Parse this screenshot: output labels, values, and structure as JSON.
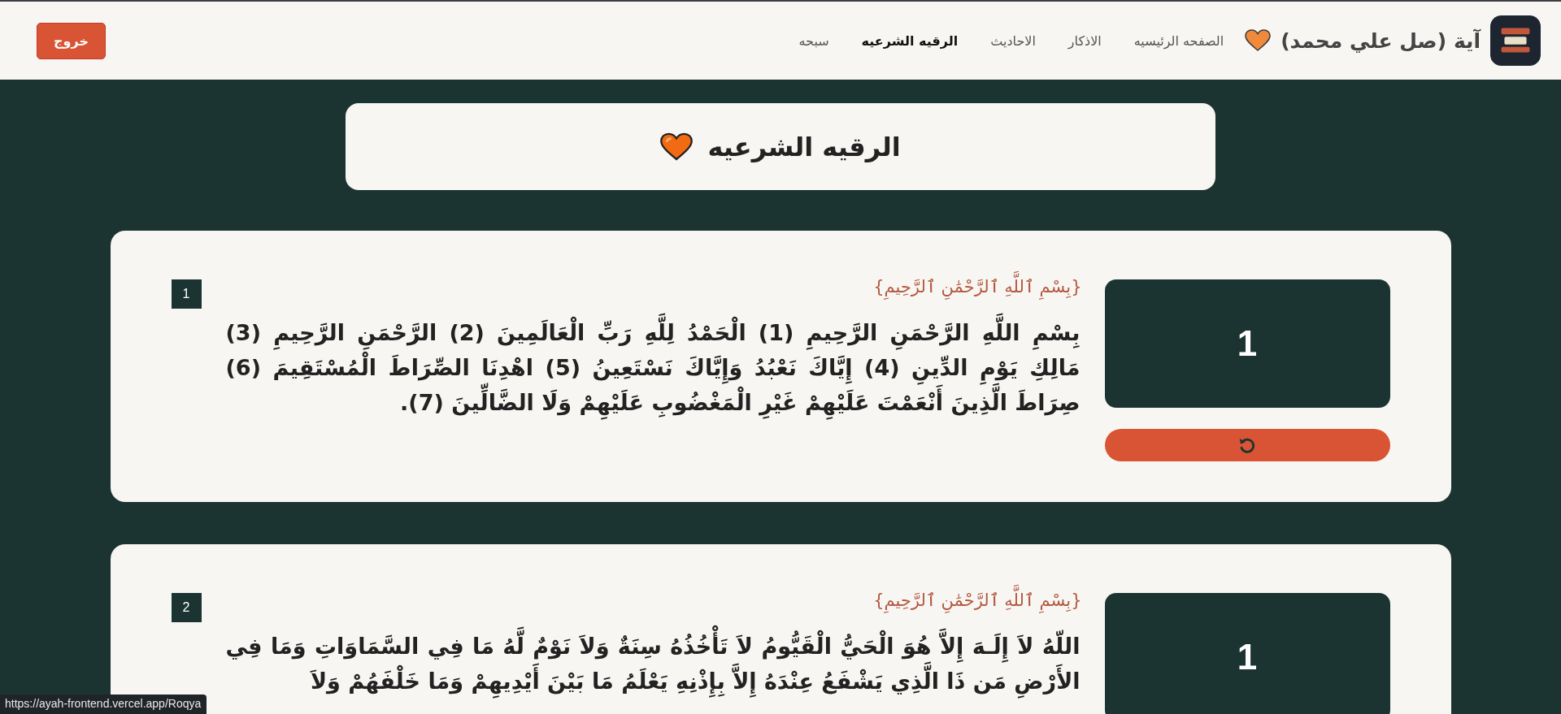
{
  "nav": {
    "brand": "آية (صل علي محمد)",
    "links": [
      {
        "label": "الصفحه الرئيسيه",
        "selected": false
      },
      {
        "label": "الاذكار",
        "selected": false
      },
      {
        "label": "الاحاديث",
        "selected": false
      },
      {
        "label": "الرقيه الشرعيه",
        "selected": true
      },
      {
        "label": "سبحه",
        "selected": false
      }
    ],
    "logout": "خروج"
  },
  "page_title": "الرقيه الشرعيه",
  "cards": [
    {
      "number": "1",
      "heading": "{بِسْمِ ٱللَّهِ ٱلرَّحْمَٰنِ ٱلرَّحِيمِ}",
      "text": "بِسْمِ اللَّهِ الرَّحْمَنِ الرَّحِيمِ (1) الْحَمْدُ لِلَّهِ رَبِّ الْعَالَمِينَ (2) الرَّحْمَنِ الرَّحِيمِ (3) مَالِكِ يَوْمِ الدِّينِ (4) إِيَّاكَ نَعْبُدُ وَإِيَّاكَ نَسْتَعِينُ (5) اهْدِنَا الصِّرَاطَ الْمُسْتَقِيمَ (6) صِرَاطَ الَّذِينَ أَنْعَمْتَ عَلَيْهِمْ غَيْرِ الْمَغْضُوبِ عَلَيْهِمْ وَلَا الضَّالِّينَ (7).",
      "count": "1",
      "reset_shown": true
    },
    {
      "number": "2",
      "heading": "{بِسْمِ ٱللَّهِ ٱلرَّحْمَٰنِ ٱلرَّحِيمِ}",
      "text": "اللّهُ لاَ إِلَـهَ إِلاَّ هُوَ الْحَيُّ الْقَيُّومُ لاَ تَأْخُذُهُ سِنَةٌ وَلاَ نَوْمٌ لَّهُ مَا فِي السَّمَاوَاتِ وَمَا فِي الأَرْضِ مَن ذَا الَّذِي يَشْفَعُ عِنْدَهُ إِلاَّ بِإِذْنِهِ يَعْلَمُ مَا بَيْنَ أَيْدِيهِمْ وَمَا خَلْفَهُمْ وَلاَ",
      "count": "1",
      "reset_shown": false
    }
  ],
  "status_url": "https://ayah-frontend.vercel.app/Roqya"
}
